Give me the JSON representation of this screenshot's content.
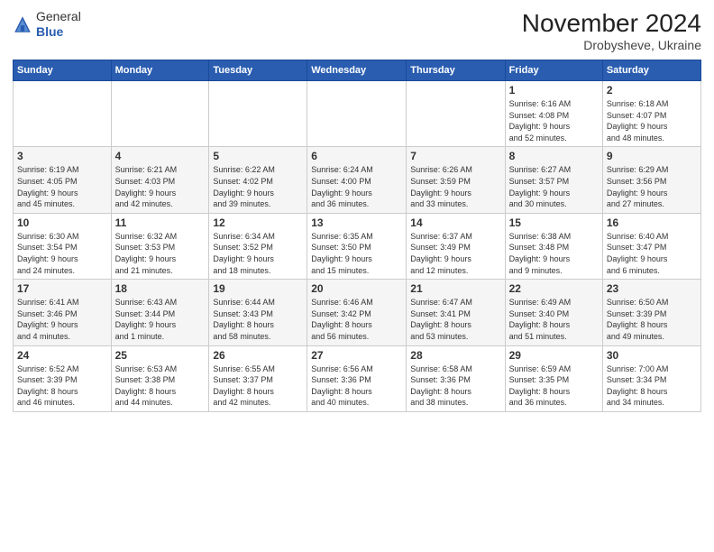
{
  "logo": {
    "general": "General",
    "blue": "Blue"
  },
  "title": "November 2024",
  "subtitle": "Drobysheve, Ukraine",
  "weekdays": [
    "Sunday",
    "Monday",
    "Tuesday",
    "Wednesday",
    "Thursday",
    "Friday",
    "Saturday"
  ],
  "weeks": [
    [
      {
        "day": "",
        "info": ""
      },
      {
        "day": "",
        "info": ""
      },
      {
        "day": "",
        "info": ""
      },
      {
        "day": "",
        "info": ""
      },
      {
        "day": "",
        "info": ""
      },
      {
        "day": "1",
        "info": "Sunrise: 6:16 AM\nSunset: 4:08 PM\nDaylight: 9 hours\nand 52 minutes."
      },
      {
        "day": "2",
        "info": "Sunrise: 6:18 AM\nSunset: 4:07 PM\nDaylight: 9 hours\nand 48 minutes."
      }
    ],
    [
      {
        "day": "3",
        "info": "Sunrise: 6:19 AM\nSunset: 4:05 PM\nDaylight: 9 hours\nand 45 minutes."
      },
      {
        "day": "4",
        "info": "Sunrise: 6:21 AM\nSunset: 4:03 PM\nDaylight: 9 hours\nand 42 minutes."
      },
      {
        "day": "5",
        "info": "Sunrise: 6:22 AM\nSunset: 4:02 PM\nDaylight: 9 hours\nand 39 minutes."
      },
      {
        "day": "6",
        "info": "Sunrise: 6:24 AM\nSunset: 4:00 PM\nDaylight: 9 hours\nand 36 minutes."
      },
      {
        "day": "7",
        "info": "Sunrise: 6:26 AM\nSunset: 3:59 PM\nDaylight: 9 hours\nand 33 minutes."
      },
      {
        "day": "8",
        "info": "Sunrise: 6:27 AM\nSunset: 3:57 PM\nDaylight: 9 hours\nand 30 minutes."
      },
      {
        "day": "9",
        "info": "Sunrise: 6:29 AM\nSunset: 3:56 PM\nDaylight: 9 hours\nand 27 minutes."
      }
    ],
    [
      {
        "day": "10",
        "info": "Sunrise: 6:30 AM\nSunset: 3:54 PM\nDaylight: 9 hours\nand 24 minutes."
      },
      {
        "day": "11",
        "info": "Sunrise: 6:32 AM\nSunset: 3:53 PM\nDaylight: 9 hours\nand 21 minutes."
      },
      {
        "day": "12",
        "info": "Sunrise: 6:34 AM\nSunset: 3:52 PM\nDaylight: 9 hours\nand 18 minutes."
      },
      {
        "day": "13",
        "info": "Sunrise: 6:35 AM\nSunset: 3:50 PM\nDaylight: 9 hours\nand 15 minutes."
      },
      {
        "day": "14",
        "info": "Sunrise: 6:37 AM\nSunset: 3:49 PM\nDaylight: 9 hours\nand 12 minutes."
      },
      {
        "day": "15",
        "info": "Sunrise: 6:38 AM\nSunset: 3:48 PM\nDaylight: 9 hours\nand 9 minutes."
      },
      {
        "day": "16",
        "info": "Sunrise: 6:40 AM\nSunset: 3:47 PM\nDaylight: 9 hours\nand 6 minutes."
      }
    ],
    [
      {
        "day": "17",
        "info": "Sunrise: 6:41 AM\nSunset: 3:46 PM\nDaylight: 9 hours\nand 4 minutes."
      },
      {
        "day": "18",
        "info": "Sunrise: 6:43 AM\nSunset: 3:44 PM\nDaylight: 9 hours\nand 1 minute."
      },
      {
        "day": "19",
        "info": "Sunrise: 6:44 AM\nSunset: 3:43 PM\nDaylight: 8 hours\nand 58 minutes."
      },
      {
        "day": "20",
        "info": "Sunrise: 6:46 AM\nSunset: 3:42 PM\nDaylight: 8 hours\nand 56 minutes."
      },
      {
        "day": "21",
        "info": "Sunrise: 6:47 AM\nSunset: 3:41 PM\nDaylight: 8 hours\nand 53 minutes."
      },
      {
        "day": "22",
        "info": "Sunrise: 6:49 AM\nSunset: 3:40 PM\nDaylight: 8 hours\nand 51 minutes."
      },
      {
        "day": "23",
        "info": "Sunrise: 6:50 AM\nSunset: 3:39 PM\nDaylight: 8 hours\nand 49 minutes."
      }
    ],
    [
      {
        "day": "24",
        "info": "Sunrise: 6:52 AM\nSunset: 3:39 PM\nDaylight: 8 hours\nand 46 minutes."
      },
      {
        "day": "25",
        "info": "Sunrise: 6:53 AM\nSunset: 3:38 PM\nDaylight: 8 hours\nand 44 minutes."
      },
      {
        "day": "26",
        "info": "Sunrise: 6:55 AM\nSunset: 3:37 PM\nDaylight: 8 hours\nand 42 minutes."
      },
      {
        "day": "27",
        "info": "Sunrise: 6:56 AM\nSunset: 3:36 PM\nDaylight: 8 hours\nand 40 minutes."
      },
      {
        "day": "28",
        "info": "Sunrise: 6:58 AM\nSunset: 3:36 PM\nDaylight: 8 hours\nand 38 minutes."
      },
      {
        "day": "29",
        "info": "Sunrise: 6:59 AM\nSunset: 3:35 PM\nDaylight: 8 hours\nand 36 minutes."
      },
      {
        "day": "30",
        "info": "Sunrise: 7:00 AM\nSunset: 3:34 PM\nDaylight: 8 hours\nand 34 minutes."
      }
    ]
  ]
}
